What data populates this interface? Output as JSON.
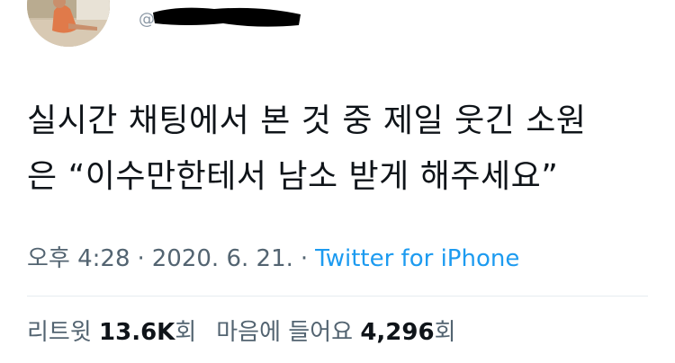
{
  "tweet": {
    "text_lines": [
      "실시간 채팅에서 본 것 중 제일 웃긴 소원",
      "은 “이수만한테서 남소 받게 해주세요”"
    ],
    "meta": {
      "time": "오후 4:28",
      "separator": "·",
      "date": "2020. 6. 21.",
      "source": "Twitter for iPhone"
    },
    "stats": {
      "retweets_label": "리트윗",
      "retweets_value": "13.6K",
      "retweets_unit": "회",
      "likes_label": "마음에 들어요",
      "likes_value": "4,296",
      "likes_unit": "회"
    }
  },
  "colors": {
    "link": "#1d9bf0",
    "secondary_text": "#536471",
    "primary_text": "#0f1419",
    "redaction": "#000000"
  }
}
